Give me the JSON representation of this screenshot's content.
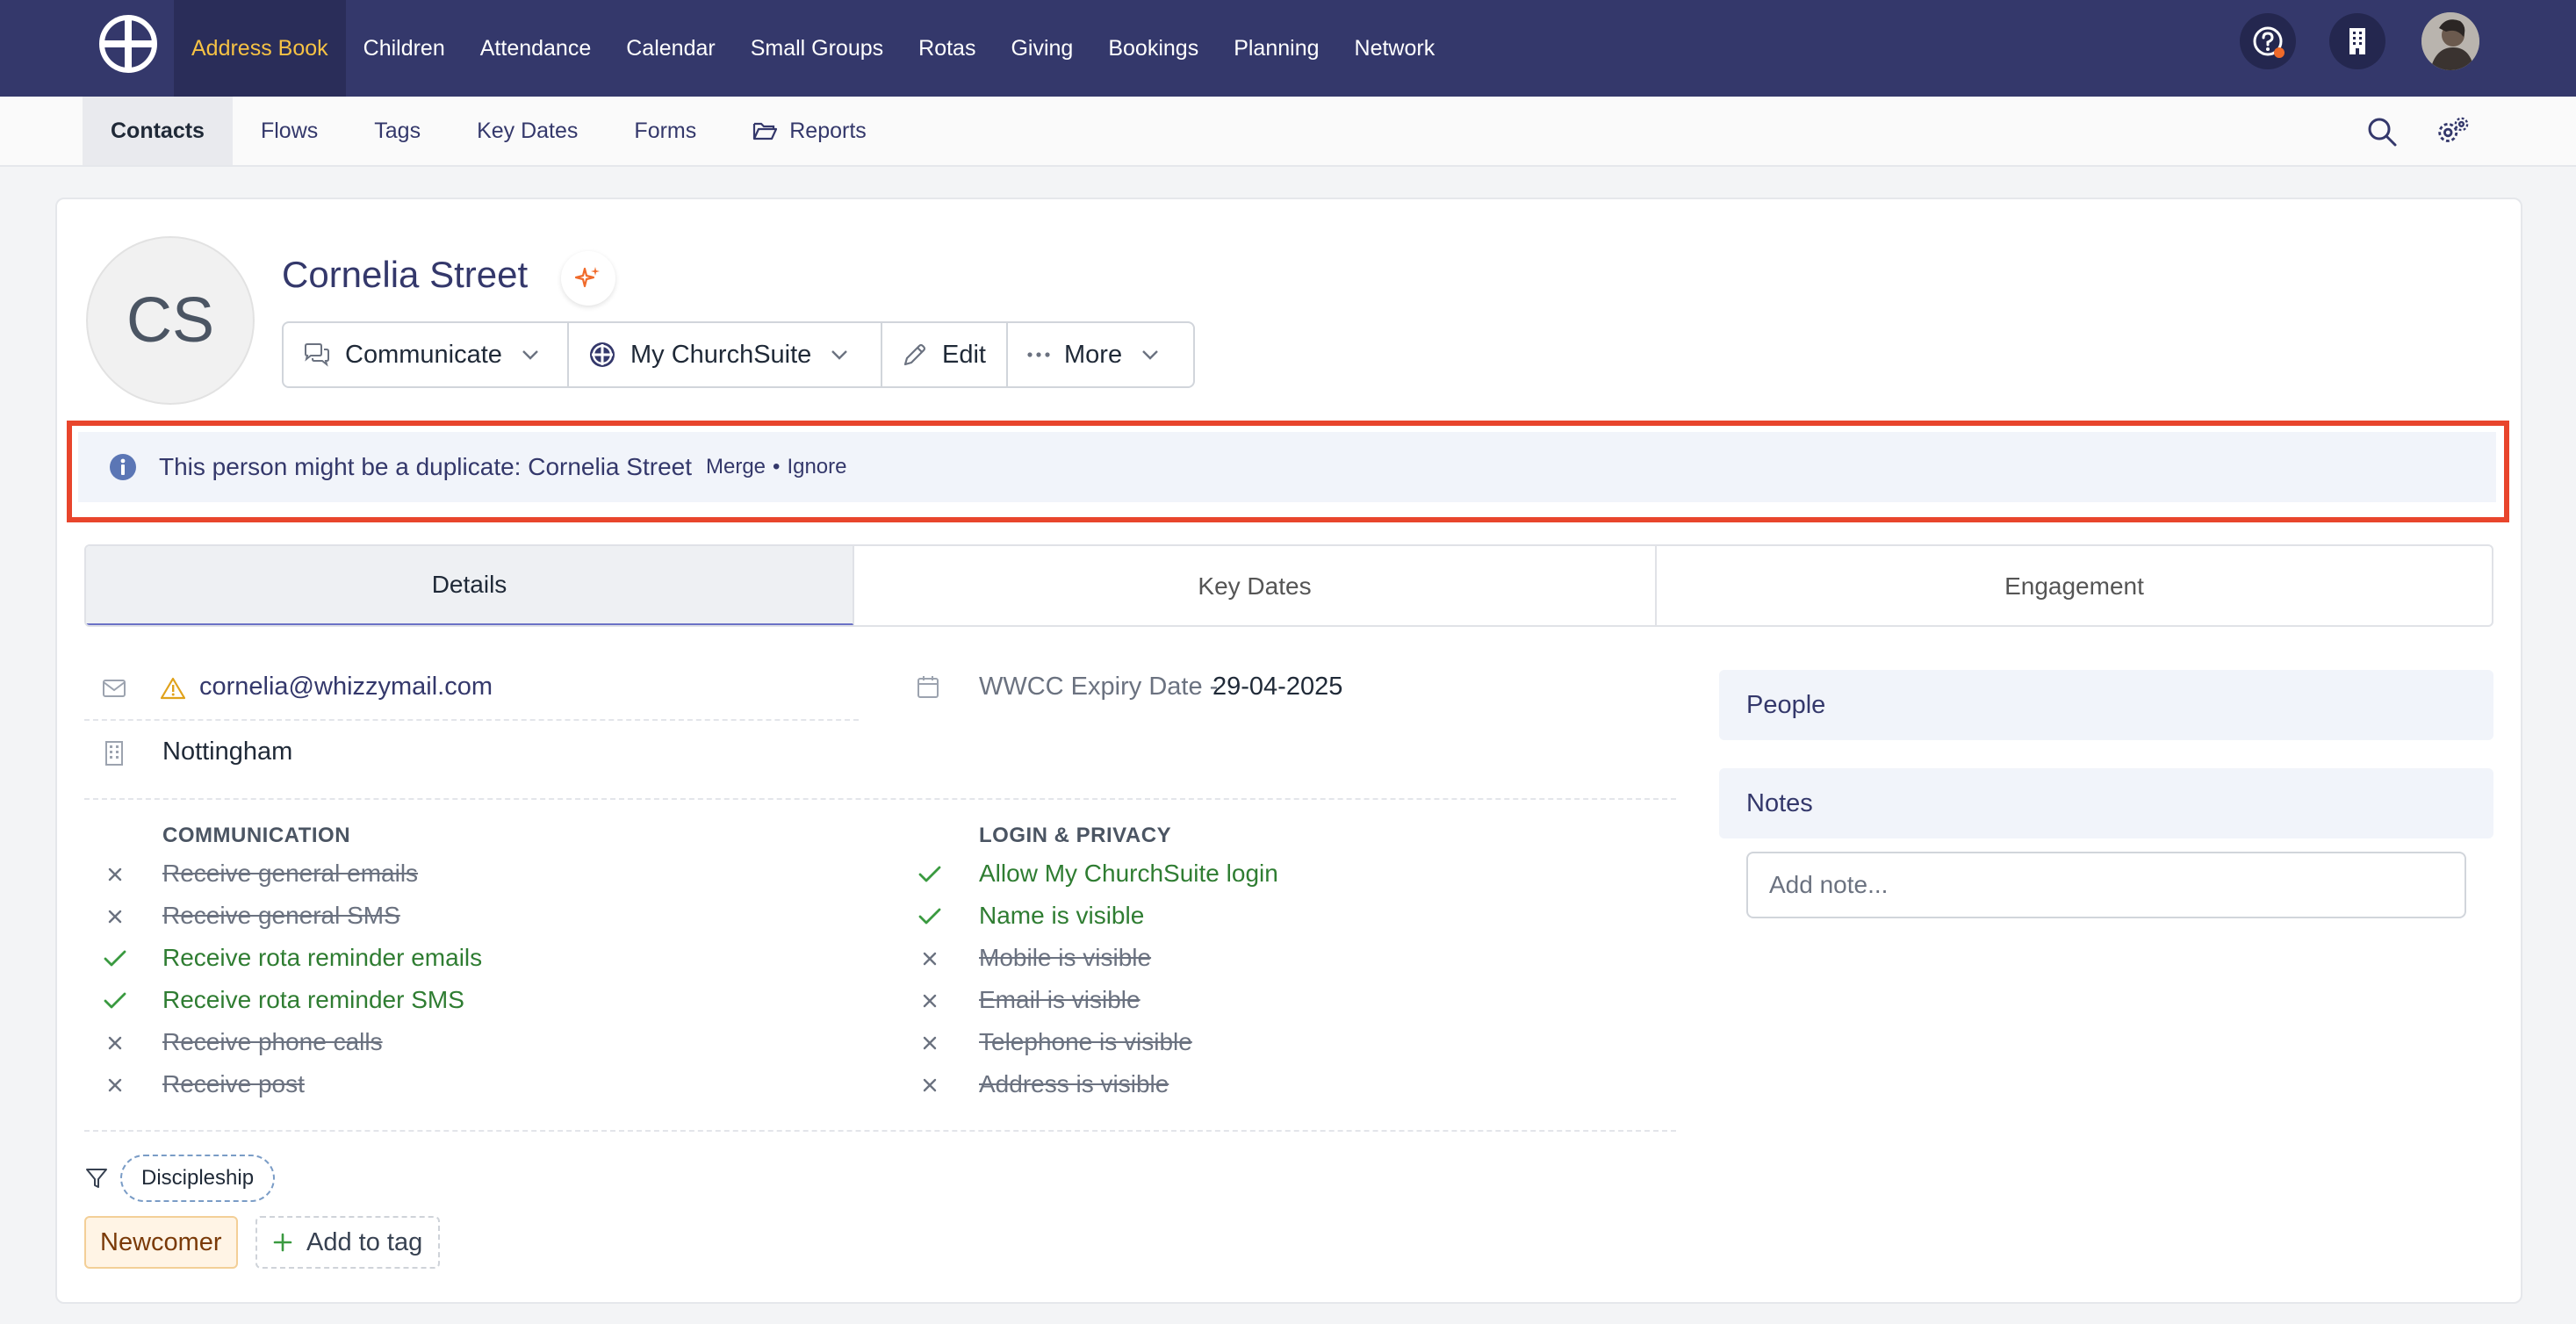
{
  "topnav": {
    "logo_icon": "churchsuite-logo-icon",
    "items": [
      {
        "label": "Address Book",
        "active": true
      },
      {
        "label": "Children"
      },
      {
        "label": "Attendance"
      },
      {
        "label": "Calendar"
      },
      {
        "label": "Small Groups"
      },
      {
        "label": "Rotas"
      },
      {
        "label": "Giving"
      },
      {
        "label": "Bookings"
      },
      {
        "label": "Planning"
      },
      {
        "label": "Network"
      }
    ],
    "right_icons": [
      "help-icon",
      "building-icon",
      "user-avatar"
    ]
  },
  "subnav": {
    "items": [
      {
        "label": "Contacts",
        "active": true
      },
      {
        "label": "Flows"
      },
      {
        "label": "Tags"
      },
      {
        "label": "Key Dates"
      },
      {
        "label": "Forms"
      },
      {
        "label": "Reports",
        "icon": "folder-open-icon"
      }
    ],
    "right_icons": [
      "search-icon",
      "settings-gears-icon"
    ]
  },
  "contact": {
    "initials": "CS",
    "name": "Cornelia Street",
    "actions": {
      "communicate": "Communicate",
      "my_churchsuite": "My ChurchSuite",
      "edit": "Edit",
      "more": "More"
    }
  },
  "duplicate_banner": {
    "message": "This person might be a duplicate: Cornelia Street",
    "merge": "Merge",
    "separator": "•",
    "ignore": "Ignore"
  },
  "tabs": [
    {
      "label": "Details",
      "active": true
    },
    {
      "label": "Key Dates"
    },
    {
      "label": "Engagement"
    }
  ],
  "details": {
    "email": "cornelia@whizzymail.com",
    "address": "Nottingham",
    "key_date_label": "WWCC Expiry Date -",
    "key_date_value": "29-04-2025"
  },
  "communication": {
    "heading": "COMMUNICATION",
    "items": [
      {
        "label": "Receive general emails",
        "enabled": false
      },
      {
        "label": "Receive general SMS",
        "enabled": false
      },
      {
        "label": "Receive rota reminder emails",
        "enabled": true
      },
      {
        "label": "Receive rota reminder SMS",
        "enabled": true
      },
      {
        "label": "Receive phone calls",
        "enabled": false
      },
      {
        "label": "Receive post",
        "enabled": false
      }
    ]
  },
  "privacy": {
    "heading": "LOGIN & PRIVACY",
    "items": [
      {
        "label": "Allow My ChurchSuite login",
        "enabled": true
      },
      {
        "label": "Name is visible",
        "enabled": true
      },
      {
        "label": "Mobile is visible",
        "enabled": false
      },
      {
        "label": "Email is visible",
        "enabled": false
      },
      {
        "label": "Telephone is visible",
        "enabled": false
      },
      {
        "label": "Address is visible",
        "enabled": false
      }
    ]
  },
  "side": {
    "people": "People",
    "notes": "Notes",
    "note_placeholder": "Add note..."
  },
  "tags": {
    "flow_chip": "Discipleship",
    "tag": "Newcomer",
    "add_tag": "Add to tag"
  },
  "colors": {
    "nav_bg": "#34386b",
    "nav_active": "#f6c244",
    "duplicate_outline": "#e8452c",
    "enabled_green": "#2f7d32"
  }
}
